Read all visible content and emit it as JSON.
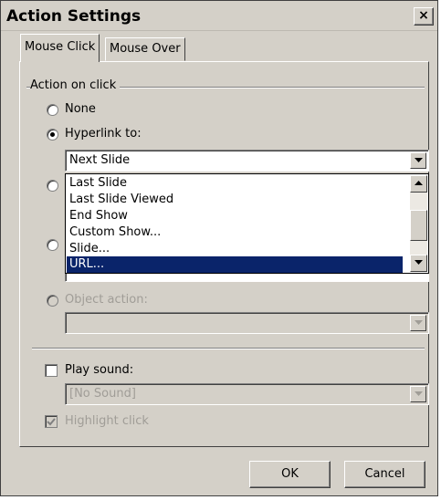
{
  "window": {
    "title": "Action Settings",
    "close_label": "×"
  },
  "tabs": [
    {
      "label": "Mouse Click",
      "active": true
    },
    {
      "label": "Mouse Over",
      "active": false
    }
  ],
  "action_group": {
    "label": "Action on click",
    "options": {
      "none": {
        "label": "None",
        "selected": false
      },
      "hyperlink": {
        "label": "Hyperlink to:",
        "selected": true
      },
      "object_action": {
        "label": "Object action:",
        "enabled": false
      }
    },
    "hyperlink_combo": {
      "value": "Next Slide",
      "dropdown_open": true,
      "items": [
        "Last Slide",
        "Last Slide Viewed",
        "End Show",
        "Custom Show...",
        "Slide...",
        "URL..."
      ],
      "highlighted_item": "URL..."
    }
  },
  "sound": {
    "label": "Play sound:",
    "checked": false,
    "value": "[No Sound]"
  },
  "highlight": {
    "label": "Highlight click",
    "checked": true,
    "enabled": false
  },
  "buttons": {
    "ok": "OK",
    "cancel": "Cancel"
  },
  "colors": {
    "face": "#d4d0c8",
    "highlight": "#0a246a"
  }
}
